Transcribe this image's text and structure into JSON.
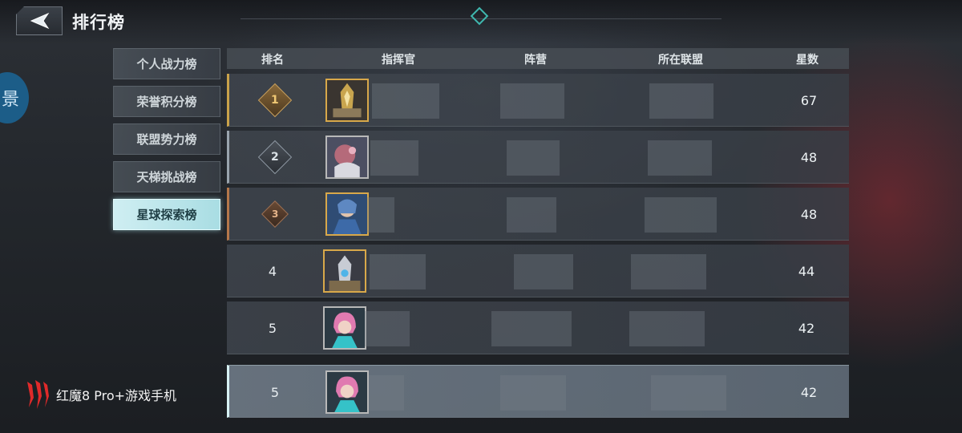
{
  "header": {
    "title": "排行榜",
    "back_icon": "back-arrow-icon"
  },
  "side": {
    "partial_glyph": "景"
  },
  "tabs": [
    {
      "label": "个人战力榜",
      "active": false
    },
    {
      "label": "荣誉积分榜",
      "active": false
    },
    {
      "label": "联盟势力榜",
      "active": false
    },
    {
      "label": "天梯挑战榜",
      "active": false
    },
    {
      "label": "星球探索榜",
      "active": true
    }
  ],
  "table": {
    "columns": {
      "rank": "排名",
      "commander": "指挥官",
      "faction": "阵营",
      "alliance": "所在联盟",
      "stars": "星数"
    },
    "rows": [
      {
        "rank": "1",
        "stars": "67",
        "style": "gold"
      },
      {
        "rank": "2",
        "stars": "48",
        "style": "silver"
      },
      {
        "rank": "3",
        "stars": "48",
        "style": "bronze"
      },
      {
        "rank": "4",
        "stars": "44",
        "style": "plain"
      },
      {
        "rank": "5",
        "stars": "42",
        "style": "plain"
      }
    ],
    "my_row": {
      "rank": "5",
      "stars": "42"
    }
  },
  "watermark": {
    "text": "红魔8 Pro+游戏手机"
  },
  "colors": {
    "accent": "#3fb7ae",
    "active_tab": "#bfe8ed",
    "gold": "#c9a24a",
    "silver": "#9aa4ad",
    "bronze": "#b5774a"
  }
}
